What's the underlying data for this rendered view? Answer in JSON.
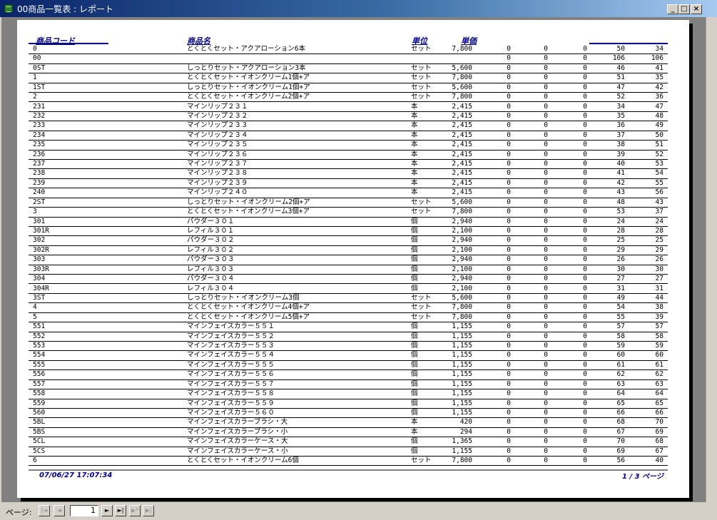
{
  "window": {
    "title": "00商品一覧表 : レポート",
    "minimize_glyph": "_",
    "maximize_glyph": "□",
    "close_glyph": "×"
  },
  "report": {
    "headers": {
      "code": "商品コード",
      "name": "商品名",
      "unit": "単位",
      "price": "単価"
    },
    "rows": [
      [
        "0",
        "とくとくセット・アクアローション6本",
        "セット",
        "7,800",
        "0",
        "0",
        "0",
        "50",
        "34"
      ],
      [
        "00",
        "",
        "",
        "",
        "0",
        "0",
        "0",
        "106",
        "106"
      ],
      [
        "0ST",
        "しっとりセット・アクアローション3本",
        "セット",
        "5,600",
        "0",
        "0",
        "0",
        "46",
        "41"
      ],
      [
        "1",
        "とくとくセット・イオンクリーム1個+ア",
        "セット",
        "7,800",
        "0",
        "0",
        "0",
        "51",
        "35"
      ],
      [
        "1ST",
        "しっとりセット・イオンクリーム1個+ア",
        "セット",
        "5,600",
        "0",
        "0",
        "0",
        "47",
        "42"
      ],
      [
        "2",
        "とくとくセット・イオンクリーム2個+ア",
        "セット",
        "7,800",
        "0",
        "0",
        "0",
        "52",
        "36"
      ],
      [
        "231",
        "マインリップ２３１",
        "本",
        "2,415",
        "0",
        "0",
        "0",
        "34",
        "47"
      ],
      [
        "232",
        "マインリップ２３２",
        "本",
        "2,415",
        "0",
        "0",
        "0",
        "35",
        "48"
      ],
      [
        "233",
        "マインリップ２３３",
        "本",
        "2,415",
        "0",
        "0",
        "0",
        "36",
        "49"
      ],
      [
        "234",
        "マインリップ２３４",
        "本",
        "2,415",
        "0",
        "0",
        "0",
        "37",
        "50"
      ],
      [
        "235",
        "マインリップ２３５",
        "本",
        "2,415",
        "0",
        "0",
        "0",
        "38",
        "51"
      ],
      [
        "236",
        "マインリップ２３６",
        "本",
        "2,415",
        "0",
        "0",
        "0",
        "39",
        "52"
      ],
      [
        "237",
        "マインリップ２３７",
        "本",
        "2,415",
        "0",
        "0",
        "0",
        "40",
        "53"
      ],
      [
        "238",
        "マインリップ２３８",
        "本",
        "2,415",
        "0",
        "0",
        "0",
        "41",
        "54"
      ],
      [
        "239",
        "マインリップ２３９",
        "本",
        "2,415",
        "0",
        "0",
        "0",
        "42",
        "55"
      ],
      [
        "240",
        "マインリップ２４０",
        "本",
        "2,415",
        "0",
        "0",
        "0",
        "43",
        "56"
      ],
      [
        "2ST",
        "しっとりセット・イオンクリーム2個+ア",
        "セット",
        "5,600",
        "0",
        "0",
        "0",
        "48",
        "43"
      ],
      [
        "3",
        "とくとくセット・イオンクリーム3個+ア",
        "セット",
        "7,800",
        "0",
        "0",
        "0",
        "53",
        "37"
      ],
      [
        "301",
        "パウダー３０１",
        "個",
        "2,940",
        "0",
        "0",
        "0",
        "24",
        "24"
      ],
      [
        "301R",
        "レフィル３０１",
        "個",
        "2,100",
        "0",
        "0",
        "0",
        "28",
        "28"
      ],
      [
        "302",
        "パウダー３０２",
        "個",
        "2,940",
        "0",
        "0",
        "0",
        "25",
        "25"
      ],
      [
        "302R",
        "レフィル３０２",
        "個",
        "2,100",
        "0",
        "0",
        "0",
        "29",
        "29"
      ],
      [
        "303",
        "パウダー３０３",
        "個",
        "2,940",
        "0",
        "0",
        "0",
        "26",
        "26"
      ],
      [
        "303R",
        "レフィル３０３",
        "個",
        "2,100",
        "0",
        "0",
        "0",
        "30",
        "30"
      ],
      [
        "304",
        "パウダー３０４",
        "個",
        "2,940",
        "0",
        "0",
        "0",
        "27",
        "27"
      ],
      [
        "304R",
        "レフィル３０４",
        "個",
        "2,100",
        "0",
        "0",
        "0",
        "31",
        "31"
      ],
      [
        "3ST",
        "しっとりセット・イオンクリーム3個",
        "セット",
        "5,600",
        "0",
        "0",
        "0",
        "49",
        "44"
      ],
      [
        "4",
        "とくとくセット・イオンクリーム4個+ア",
        "セット",
        "7,800",
        "0",
        "0",
        "0",
        "54",
        "38"
      ],
      [
        "5",
        "とくとくセット・イオンクリーム5個+ア",
        "セット",
        "7,800",
        "0",
        "0",
        "0",
        "55",
        "39"
      ],
      [
        "551",
        "マインフェイスカラー５５１",
        "個",
        "1,155",
        "0",
        "0",
        "0",
        "57",
        "57"
      ],
      [
        "552",
        "マインフェイスカラー５５２",
        "個",
        "1,155",
        "0",
        "0",
        "0",
        "58",
        "58"
      ],
      [
        "553",
        "マインフェイスカラー５５３",
        "個",
        "1,155",
        "0",
        "0",
        "0",
        "59",
        "59"
      ],
      [
        "554",
        "マインフェイスカラー５５４",
        "個",
        "1,155",
        "0",
        "0",
        "0",
        "60",
        "60"
      ],
      [
        "555",
        "マインフェイスカラー５５５",
        "個",
        "1,155",
        "0",
        "0",
        "0",
        "61",
        "61"
      ],
      [
        "556",
        "マインフェイスカラー５５６",
        "個",
        "1,155",
        "0",
        "0",
        "0",
        "62",
        "62"
      ],
      [
        "557",
        "マインフェイスカラー５５７",
        "個",
        "1,155",
        "0",
        "0",
        "0",
        "63",
        "63"
      ],
      [
        "558",
        "マインフェイスカラー５５８",
        "個",
        "1,155",
        "0",
        "0",
        "0",
        "64",
        "64"
      ],
      [
        "559",
        "マインフェイスカラー５５９",
        "個",
        "1,155",
        "0",
        "0",
        "0",
        "65",
        "65"
      ],
      [
        "560",
        "マインフェイスカラー５６０",
        "個",
        "1,155",
        "0",
        "0",
        "0",
        "66",
        "66"
      ],
      [
        "5BL",
        "マインフェイスカラーブラシ・大",
        "本",
        "420",
        "0",
        "0",
        "0",
        "68",
        "70"
      ],
      [
        "5BS",
        "マインフェイスカラーブラシ・小",
        "本",
        "294",
        "0",
        "0",
        "0",
        "67",
        "69"
      ],
      [
        "5CL",
        "マインフェイスカラーケース・大",
        "個",
        "1,365",
        "0",
        "0",
        "0",
        "70",
        "68"
      ],
      [
        "5CS",
        "マインフェイスカラーケース・小",
        "個",
        "1,155",
        "0",
        "0",
        "0",
        "69",
        "67"
      ],
      [
        "6",
        "とくとくセット・イオンクリーム6個",
        "セット",
        "7,800",
        "0",
        "0",
        "0",
        "56",
        "40"
      ]
    ],
    "footer": {
      "date": "07/06/27 17:07:34",
      "page": "1 / 3 ページ"
    }
  },
  "navigation": {
    "label": "ページ:",
    "current_page": "1",
    "first_glyph": "|◄",
    "prev_glyph": "◄",
    "next_glyph": "►",
    "last_glyph": "►|",
    "new_glyph": "▶*",
    "extra_glyph": "▶|"
  },
  "colors": {
    "titlebar_start": "#0a246a",
    "titlebar_end": "#a6caf0",
    "report_header": "#00008b",
    "canvas": "#808080",
    "chrome": "#d4d0c8"
  }
}
